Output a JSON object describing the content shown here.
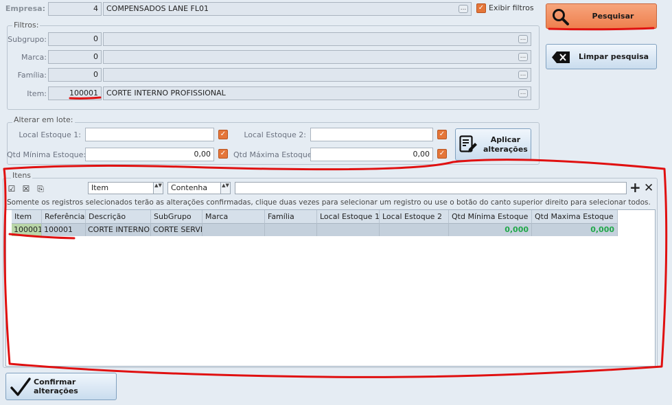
{
  "empresa": {
    "label": "Empresa:",
    "code": "4",
    "name": "COMPENSADOS LANE FL01",
    "more": "..."
  },
  "exibir_filtros": {
    "label": "Exibir filtros",
    "checked": true,
    "mark": "✓"
  },
  "filtros": {
    "title": "Filtros:",
    "subgrupo": {
      "label": "Subgrupo:",
      "code": "0",
      "desc": ""
    },
    "marca": {
      "label": "Marca:",
      "code": "0",
      "desc": ""
    },
    "familia": {
      "label": "Família:",
      "code": "0",
      "desc": ""
    },
    "item": {
      "label": "Item:",
      "code": "100001",
      "desc": "CORTE INTERNO PROFISSIONAL"
    },
    "more": "..."
  },
  "pesquisar_button": {
    "label": "Pesquisar",
    "icon": "search-icon"
  },
  "limpar_button": {
    "label": "Limpar pesquisa",
    "icon": "backspace-icon"
  },
  "lote": {
    "title": "Alterar em lote:",
    "local_estoque_1": {
      "label": "Local Estoque 1:",
      "value": ""
    },
    "local_estoque_2": {
      "label": "Local Estoque 2:",
      "value": ""
    },
    "qtd_minima": {
      "label": "Qtd Mínima Estoque:",
      "value": "0,00"
    },
    "qtd_maxima": {
      "label": "Qtd Máxima Estoque:",
      "value": "0,00"
    },
    "check_mark": "✓",
    "apply_button": {
      "label_line1": "Aplicar",
      "label_line2": "alterações",
      "icon": "edit-document-icon"
    }
  },
  "itens": {
    "title": "Itens",
    "filter_field": {
      "value": "Item",
      "spin": "▲▼"
    },
    "filter_op": {
      "value": "Contenha",
      "spin": "▲▼"
    },
    "filter_text": "",
    "add_label": "+",
    "clear_label": "✕",
    "hint": "Somente os registros selecionados terão as alterações confirmadas, clique duas vezes para selecionar um registro ou use o botão do canto superior direito para selecionar todos.",
    "columns": [
      "Item",
      "Referência",
      "Descrição",
      "SubGrupo",
      "Marca",
      "Família",
      "Local Estoque 1",
      "Local Estoque 2",
      "Qtd Mínima Estoque",
      "Qtd Maxima Estoque"
    ],
    "rows": [
      [
        "100001",
        "100001",
        "CORTE INTERNO P",
        "CORTE SERVIÇ",
        "",
        "",
        "",
        "",
        "0,000",
        "0,000"
      ]
    ]
  },
  "confirmar_button": {
    "label": "Confirmar alterações",
    "icon": "checkmark-icon"
  },
  "colors": {
    "pesquisar_bg": "#f28c5e",
    "check_orange": "#e4763a",
    "annotation_red": "#e01010",
    "qty_green": "#21a84a"
  }
}
